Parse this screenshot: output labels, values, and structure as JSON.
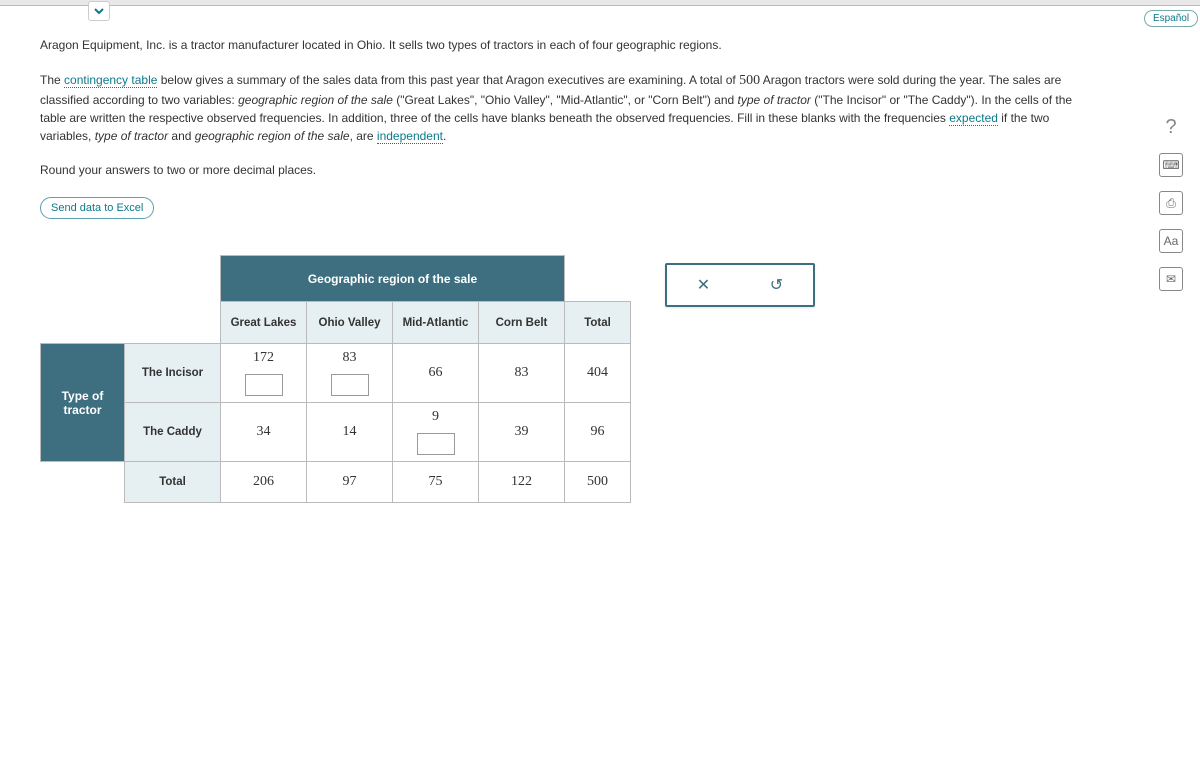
{
  "top": {
    "language_btn": "Español"
  },
  "problem": {
    "p1_a": "Aragon Equipment, Inc. is a tractor manufacturer located in Ohio. It sells two types of tractors in each of four geographic regions.",
    "p2_a": "The ",
    "p2_link1": "contingency table",
    "p2_b": " below gives a summary of the sales data from this past year that Aragon executives are examining. A total of ",
    "p2_num": "500",
    "p2_c": " Aragon tractors were sold during the year. The sales are classified according to two variables: ",
    "p2_it1": "geographic region of the sale",
    "p2_d": " (\"Great Lakes\", \"Ohio Valley\", \"Mid-Atlantic\", or \"Corn Belt\") and ",
    "p2_it2": "type of tractor",
    "p2_e": " (\"The Incisor\" or \"The Caddy\"). In the cells of the table are written the respective observed frequencies. In addition, three of the cells have blanks beneath the observed frequencies. Fill in these blanks with the frequencies ",
    "p2_link2": "expected",
    "p2_f": " if the two variables, ",
    "p2_it3": "type of tractor",
    "p2_g": " and ",
    "p2_it4": "geographic region of the sale",
    "p2_h": ", are ",
    "p2_link3": "independent",
    "p2_i": ".",
    "instruction": "Round your answers to two or more decimal places.",
    "excel_btn": "Send data to Excel"
  },
  "table": {
    "col_header_span": "Geographic region of the sale",
    "row_header_span": "Type of tractor",
    "cols": [
      "Great Lakes",
      "Ohio Valley",
      "Mid-Atlantic",
      "Corn Belt",
      "Total"
    ],
    "rows": [
      "The Incisor",
      "The Caddy",
      "Total"
    ],
    "incisor": {
      "gl": "172",
      "ov": "83",
      "ma": "66",
      "cb": "83",
      "total": "404"
    },
    "caddy": {
      "gl": "34",
      "ov": "14",
      "ma": "9",
      "cb": "39",
      "total": "96"
    },
    "total": {
      "gl": "206",
      "ov": "97",
      "ma": "75",
      "cb": "122",
      "total": "500"
    }
  },
  "tools": {
    "clear": "✕",
    "reset": "↺"
  },
  "rail": {
    "help": "?",
    "calc": "⌨",
    "print": "⎙",
    "font": "Aa",
    "mail": "✉"
  }
}
